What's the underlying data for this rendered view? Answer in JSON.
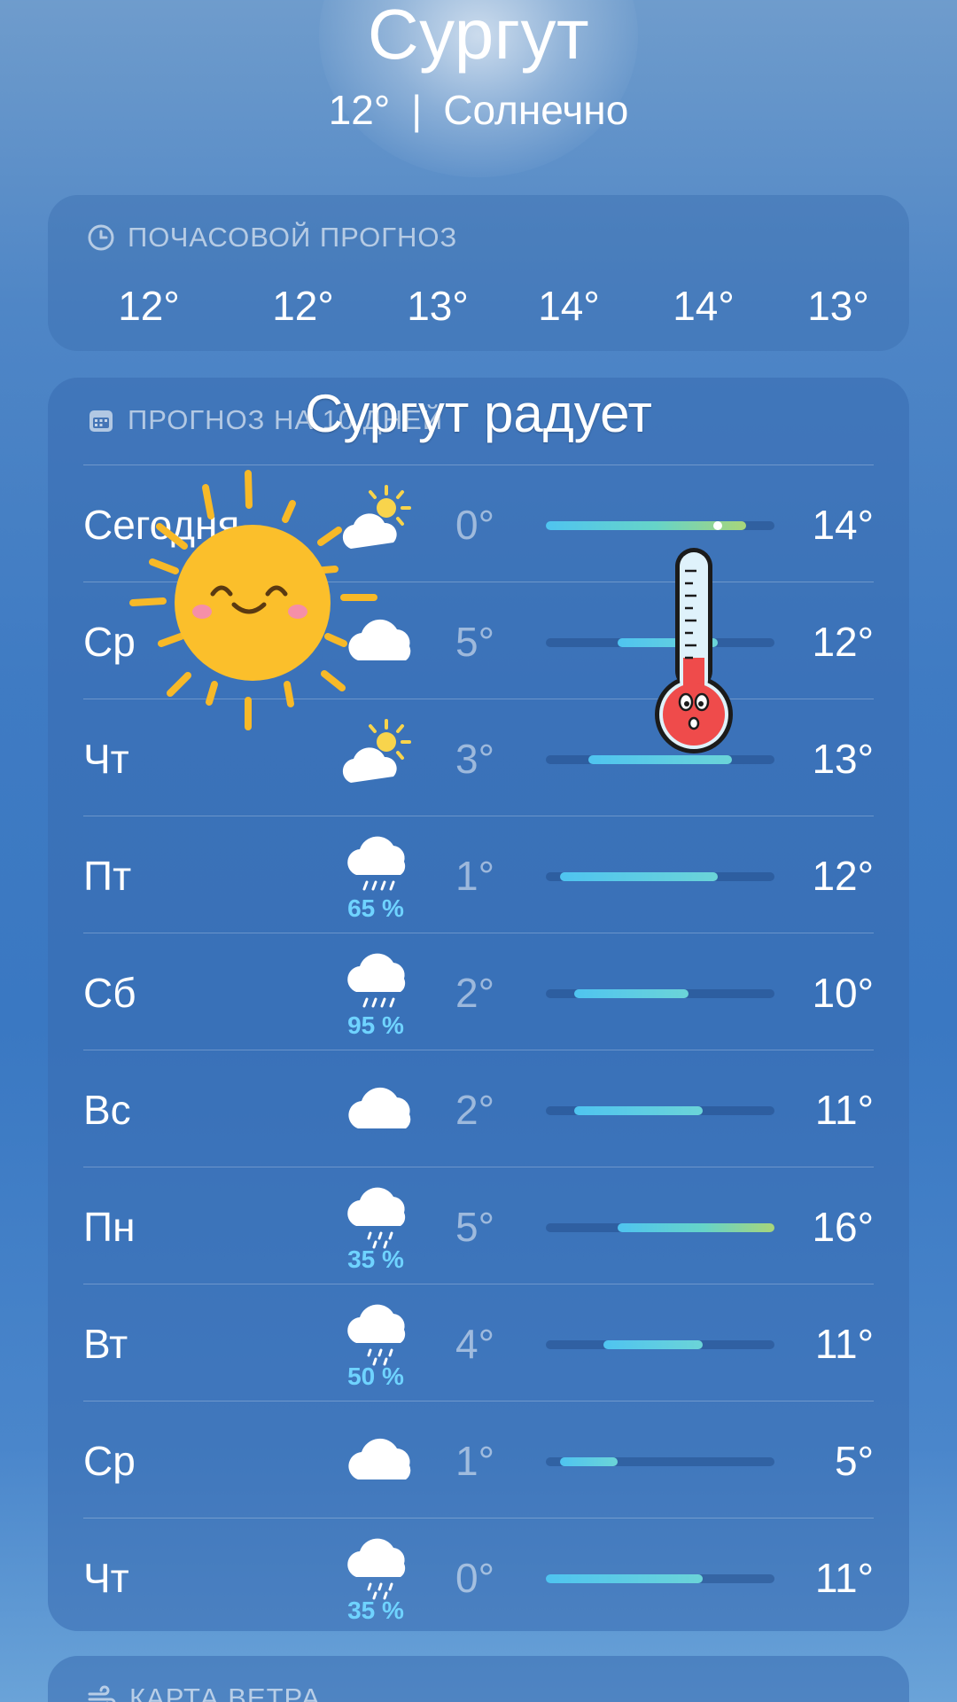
{
  "header": {
    "city": "Сургут",
    "current_temp": "12°",
    "separator": "|",
    "condition": "Солнечно"
  },
  "hourly": {
    "label": "ПОЧАСОВОЙ ПРОГНОЗ",
    "temps": [
      "12°",
      "12°",
      "13°",
      "14°",
      "14°",
      "13°"
    ]
  },
  "daily": {
    "label": "ПРОГНОЗ НА 10 ДНЕЙ",
    "overlay_title": "Сургут радует",
    "range": {
      "min": 0,
      "max": 16
    },
    "rows": [
      {
        "day": "Сегодня",
        "icon": "partly-sunny-icon",
        "precip": "",
        "min": "0°",
        "max": "14°",
        "min_val": 0,
        "max_val": 14,
        "current_val": 12
      },
      {
        "day": "Ср",
        "icon": "cloud-icon",
        "precip": "",
        "min": "5°",
        "max": "12°",
        "min_val": 5,
        "max_val": 12
      },
      {
        "day": "Чт",
        "icon": "partly-sunny-icon",
        "precip": "",
        "min": "3°",
        "max": "13°",
        "min_val": 3,
        "max_val": 13
      },
      {
        "day": "Пт",
        "icon": "rain-icon",
        "precip": "65 %",
        "min": "1°",
        "max": "12°",
        "min_val": 1,
        "max_val": 12
      },
      {
        "day": "Сб",
        "icon": "rain-icon",
        "precip": "95 %",
        "min": "2°",
        "max": "10°",
        "min_val": 2,
        "max_val": 10
      },
      {
        "day": "Вс",
        "icon": "cloud-icon",
        "precip": "",
        "min": "2°",
        "max": "11°",
        "min_val": 2,
        "max_val": 11
      },
      {
        "day": "Пн",
        "icon": "drizzle-icon",
        "precip": "35 %",
        "min": "5°",
        "max": "16°",
        "min_val": 5,
        "max_val": 16
      },
      {
        "day": "Вт",
        "icon": "drizzle-icon",
        "precip": "50 %",
        "min": "4°",
        "max": "11°",
        "min_val": 4,
        "max_val": 11
      },
      {
        "day": "Ср",
        "icon": "cloud-icon",
        "precip": "",
        "min": "1°",
        "max": "5°",
        "min_val": 1,
        "max_val": 5
      },
      {
        "day": "Чт",
        "icon": "drizzle-icon",
        "precip": "35 %",
        "min": "0°",
        "max": "11°",
        "min_val": 0,
        "max_val": 11
      }
    ]
  },
  "wind": {
    "label": "КАРТА ВЕТРА"
  },
  "colors": {
    "bar_cool": "#4fc4f0",
    "bar_warm": "#a8d57a",
    "precip_text": "#6fd3ff"
  }
}
